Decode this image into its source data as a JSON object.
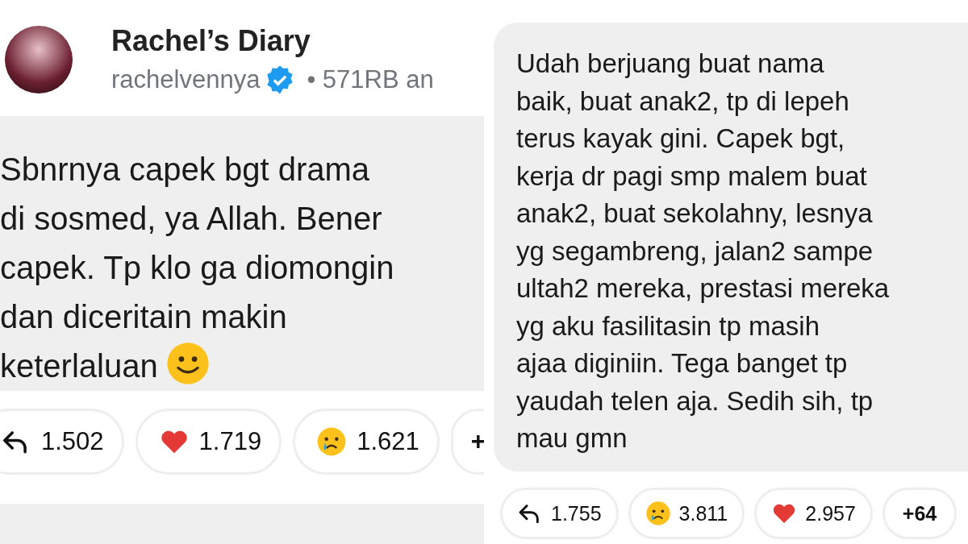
{
  "left_panel": {
    "channel": {
      "name": "Rachel’s Diary",
      "handle": "rachelvennya",
      "verified": true,
      "meta": "• 571RB an"
    },
    "message": {
      "text": "Sbnrnya capek bgt drama\ndi sosmed, ya Allah. Bener\ncapek. Tp klo ga diomongin\ndan diceritain makin\nketerlaluan",
      "smiley": true
    },
    "reactions": [
      {
        "kind": "reply",
        "count": "1.502"
      },
      {
        "kind": "heart",
        "count": "1.719"
      },
      {
        "kind": "cry",
        "count": "1.621"
      },
      {
        "kind": "more",
        "count": "+"
      }
    ]
  },
  "right_panel": {
    "message": {
      "text": "Udah berjuang buat nama\nbaik, buat anak2, tp di lepeh\nterus kayak gini. Capek bgt,\nkerja dr pagi smp malem buat\nanak2, buat sekolahny, lesnya\nyg segambreng, jalan2 sampe\nultah2 mereka, prestasi mereka\nyg aku fasilitasin tp masih\najaa diginiin. Tega banget tp\nyaudah telen aja. Sedih sih, tp\nmau gmn"
    },
    "reactions": [
      {
        "kind": "reply",
        "count": "1.755"
      },
      {
        "kind": "cry",
        "count": "3.811"
      },
      {
        "kind": "heart",
        "count": "2.957"
      },
      {
        "kind": "more",
        "count": "+64"
      }
    ]
  }
}
